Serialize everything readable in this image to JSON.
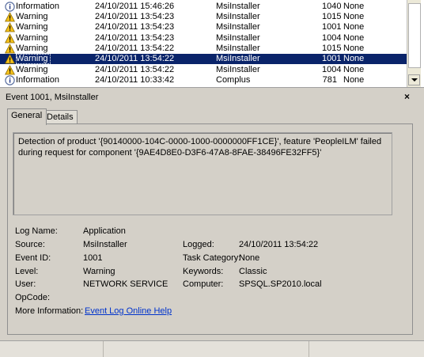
{
  "event_list": {
    "rows": [
      {
        "level": "Information",
        "date": "24/10/2011 15:46:26",
        "source": "MsiInstaller",
        "id": "1040",
        "category": "None",
        "icon": "info-icon"
      },
      {
        "level": "Warning",
        "date": "24/10/2011 13:54:23",
        "source": "MsiInstaller",
        "id": "1015",
        "category": "None",
        "icon": "warning-icon"
      },
      {
        "level": "Warning",
        "date": "24/10/2011 13:54:23",
        "source": "MsiInstaller",
        "id": "1001",
        "category": "None",
        "icon": "warning-icon"
      },
      {
        "level": "Warning",
        "date": "24/10/2011 13:54:23",
        "source": "MsiInstaller",
        "id": "1004",
        "category": "None",
        "icon": "warning-icon"
      },
      {
        "level": "Warning",
        "date": "24/10/2011 13:54:22",
        "source": "MsiInstaller",
        "id": "1015",
        "category": "None",
        "icon": "warning-icon"
      },
      {
        "level": "Warning",
        "date": "24/10/2011 13:54:22",
        "source": "MsiInstaller",
        "id": "1001",
        "category": "None",
        "icon": "warning-icon",
        "selected": true
      },
      {
        "level": "Warning",
        "date": "24/10/2011 13:54:22",
        "source": "MsiInstaller",
        "id": "1004",
        "category": "None",
        "icon": "warning-icon"
      },
      {
        "level": "Information",
        "date": "24/10/2011 10:33:42",
        "source": "Complus",
        "id": "781",
        "category": "None",
        "icon": "info-icon"
      }
    ],
    "selection_color": "#0a246a"
  },
  "detail": {
    "title": "Event 1001, MsiInstaller",
    "close_label": "×",
    "tabs": [
      "General",
      "Details"
    ],
    "description": "Detection of product '{90140000-104C-0000-1000-0000000FF1CE}', feature 'PeopleILM' failed during request for component '{9AE4D8E0-D3F6-47A8-8FAE-38496FE32FF5}'",
    "fields": {
      "log_name_label": "Log Name:",
      "log_name": "Application",
      "source_label": "Source:",
      "source": "MsiInstaller",
      "logged_label": "Logged:",
      "logged": "24/10/2011 13:54:22",
      "event_id_label": "Event ID:",
      "event_id": "1001",
      "task_category_label": "Task Category:",
      "task_category": "None",
      "level_label": "Level:",
      "level": "Warning",
      "keywords_label": "Keywords:",
      "keywords": "Classic",
      "user_label": "User:",
      "user": "NETWORK SERVICE",
      "computer_label": "Computer:",
      "computer": "SPSQL.SP2010.local",
      "opcode_label": "OpCode:",
      "opcode": "",
      "more_info_label": "More Information:",
      "more_info_link": "Event Log Online Help"
    }
  }
}
